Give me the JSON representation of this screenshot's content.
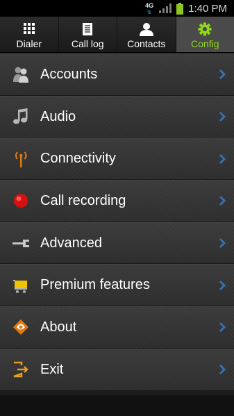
{
  "status_bar": {
    "network_type": "4G",
    "time": "1:40 PM",
    "battery_color": "#8ec51f",
    "icons": [
      "network-4g-icon",
      "signal-icon",
      "battery-icon"
    ]
  },
  "tabs": [
    {
      "label": "Dialer",
      "icon": "dialpad-icon",
      "active": false
    },
    {
      "label": "Call log",
      "icon": "call-log-icon",
      "active": false
    },
    {
      "label": "Contacts",
      "icon": "contacts-icon",
      "active": false
    },
    {
      "label": "Config",
      "icon": "gear-icon",
      "active": true
    }
  ],
  "accent_color": "#8fd61b",
  "menu": {
    "items": [
      {
        "label": "Accounts",
        "icon": "accounts-icon"
      },
      {
        "label": "Audio",
        "icon": "music-note-icon"
      },
      {
        "label": "Connectivity",
        "icon": "antenna-icon"
      },
      {
        "label": "Call recording",
        "icon": "record-icon"
      },
      {
        "label": "Advanced",
        "icon": "wrench-icon"
      },
      {
        "label": "Premium features",
        "icon": "cart-icon"
      },
      {
        "label": "About",
        "icon": "info-icon"
      },
      {
        "label": "Exit",
        "icon": "exit-icon"
      }
    ],
    "chevron_icon": "chevron-right-icon",
    "chevron_color": "#3a6fb0"
  }
}
